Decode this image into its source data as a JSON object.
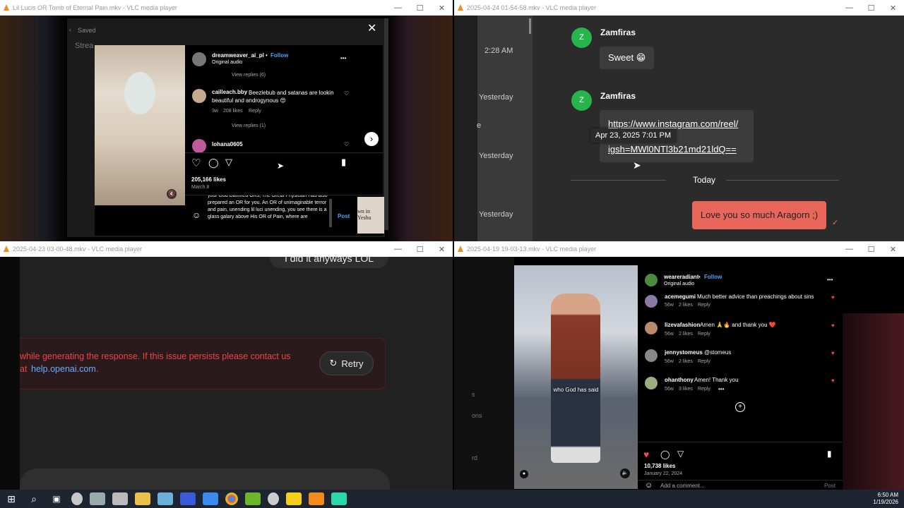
{
  "windows": {
    "w1": {
      "title": "Lil Lucis OR Tomb of Eternal Pain.mkv - VLC media player",
      "bg_saved": "Saved",
      "bg_stream": "Strea",
      "ig": {
        "username": "dreamweaver_ai_pl",
        "dot": "•",
        "follow": "Follow",
        "audio": "Original audio",
        "more": "•••",
        "view_replies_6": "View replies (6)",
        "comment_user": "cailleach.bby",
        "comment_text": "Beezlebub and satanas are lookin beautiful and androgynous 😍",
        "comment_age": "3w",
        "comment_likes": "208 likes",
        "comment_reply": "Reply",
        "view_replies_1": "View replies (1)",
        "next_user": "lohana0605",
        "likes": "205,166 likes",
        "date": "March 8",
        "typing": "your God Damned ORs, The Great Physician Has also prepared an OR for you. An OR of unimaginable terror and pain, unending lil luci unending, you see there is a glass galary above His OR of Pain, where are",
        "post": "Post",
        "right_text": "wn in\nYeshu"
      }
    },
    "w2": {
      "title": "2025-04-24 01-54-58.mkv - VLC media player",
      "time1": "2:28 AM",
      "day1": "Yesterday",
      "day2": "Yesterday",
      "day3": "Yesterday",
      "edge_char": "e",
      "sender1": "Zamfiras",
      "avatar_letter": "Z",
      "msg1": "Sweet 😁",
      "sender2": "Zamfiras",
      "msg2_line1": "https://www.instagram.com/reel/",
      "msg2_line2": "igsh=MWl0NTl3b21md21ldQ==",
      "tooltip": "Apr 23, 2025 7:01 PM",
      "today": "Today",
      "msg3": "Love you so much Aragorn ;)"
    },
    "w3": {
      "title": "2025-04-23 03-00-48.mkv - VLC media player",
      "top_bubble": "I did it anyways LOL",
      "error_line1": "while generating the response. If this issue persists please contact us",
      "error_at": "at",
      "error_link": "help.openai.com",
      "error_end": ".",
      "retry": "Retry"
    },
    "w4": {
      "title": "2025-04-19 19-03-13.mkv - VLC media player",
      "caption": "who God has said",
      "username": "weareradiant",
      "dot": "•",
      "follow": "Follow",
      "audio": "Original audio",
      "more": "•••",
      "comments": [
        {
          "user": "acemegumi",
          "text": "Much better advice than preachings about sins",
          "age": "56w",
          "likes": "2 likes",
          "reply": "Reply"
        },
        {
          "user": "lizevafashion",
          "text": "Amen 🙏🔥 and thank you ❤️",
          "age": "56w",
          "likes": "2 likes",
          "reply": "Reply"
        },
        {
          "user": "jennystomeus",
          "text": "@stomeus",
          "age": "56w",
          "likes": "2 likes",
          "reply": "Reply"
        },
        {
          "user": "ohanthony",
          "text": "Amen! Thank you",
          "age": "56w",
          "likes": "3 likes",
          "reply": "Reply"
        }
      ],
      "likes": "10,738 likes",
      "date": "January 22, 2024",
      "add_comment": "Add a comment...",
      "post": "Post",
      "left_chars": [
        "s",
        "ons",
        "rd"
      ]
    }
  },
  "taskbar": {
    "time": "6:50 AM",
    "date": "1/19/2026"
  }
}
